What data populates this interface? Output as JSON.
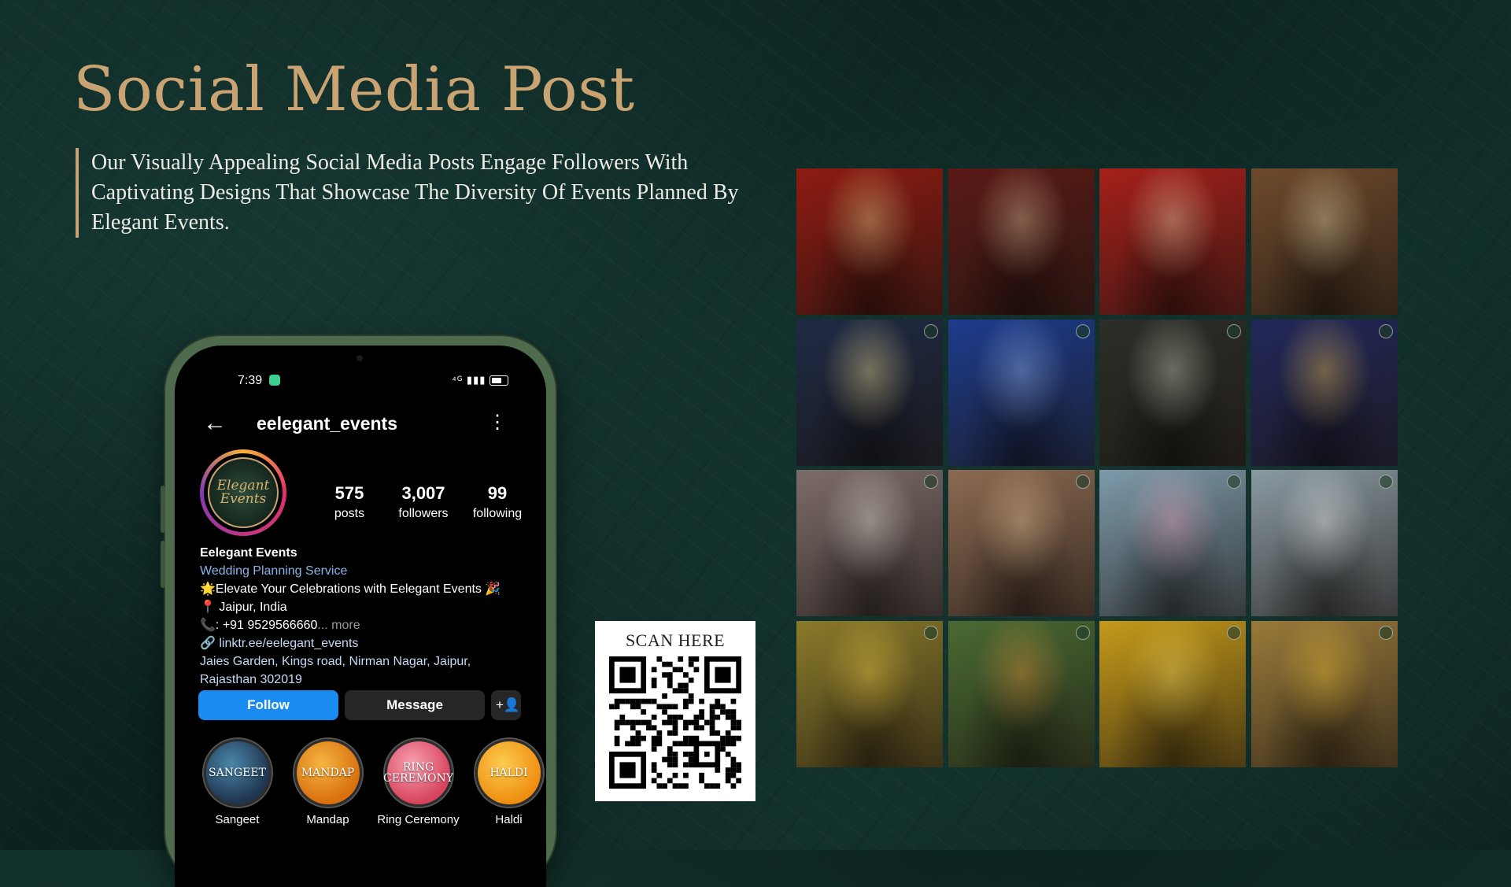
{
  "slide": {
    "title": "Social Media Post",
    "description": "Our Visually Appealing Social Media Posts Engage Followers With Captivating Designs That Showcase The Diversity Of Events Planned By Elegant Events."
  },
  "phone": {
    "status_time": "7:39",
    "status_icons": "⁴ᴳ ▮▮▮",
    "profile": {
      "username": "eelegant_events",
      "avatar_text": "Elegant Events",
      "stats": [
        {
          "num": "575",
          "label": "posts"
        },
        {
          "num": "3,007",
          "label": "followers"
        },
        {
          "num": "99",
          "label": "following"
        }
      ],
      "name": "Eelegant Events",
      "category": "Wedding Planning Service",
      "bio_line1": "🌟Elevate Your Celebrations with Eelegant Events 🎉",
      "location": "📍 Jaipur, India",
      "phone": "📞: +91 9529566660",
      "more": "... more",
      "link": "🔗 linktr.ee/eelegant_events",
      "address": "Jaies Garden, Kings road, Nirman Nagar, Jaipur, Rajasthan 302019"
    },
    "buttons": {
      "follow": "Follow",
      "message": "Message",
      "add_user": "+👤"
    },
    "highlights": [
      {
        "cover": "SANGEET",
        "label": "Sangeet",
        "color": "#2a4a6a"
      },
      {
        "cover": "MANDAP",
        "label": "Mandap",
        "color": "#e8901a"
      },
      {
        "cover": "RING CEREMONY",
        "label": "Ring Ceremony",
        "color": "#e8607a"
      },
      {
        "cover": "HALDI",
        "label": "Haldi",
        "color": "#f3a320"
      }
    ]
  },
  "qr": {
    "label": "SCAN HERE"
  },
  "grid_tiles": [
    {
      "name": "red-mandap-decor",
      "bg": "#8e1b12"
    },
    {
      "name": "couple-portrait",
      "bg": "#5a1a16"
    },
    {
      "name": "crystal-chandelier-red",
      "bg": "#a5201a"
    },
    {
      "name": "outdoor-lounge-setup",
      "bg": "#6e4a2c"
    },
    {
      "name": "hanging-lights-venue",
      "bg": "#1e2a44"
    },
    {
      "name": "blue-lit-gate",
      "bg": "#1d3c8c"
    },
    {
      "name": "white-drape-tent",
      "bg": "#2c2e28"
    },
    {
      "name": "welcome-board",
      "bg": "#22285a"
    },
    {
      "name": "lakeside-floral-mandap",
      "bg": "#7c6c6a"
    },
    {
      "name": "sunset-mandap",
      "bg": "#8c6a52"
    },
    {
      "name": "floral-canopy-pink",
      "bg": "#7d9aaa"
    },
    {
      "name": "white-floral-arch-lake",
      "bg": "#8a9aa2"
    },
    {
      "name": "haldi-yellow-setup",
      "bg": "#8a7a2a"
    },
    {
      "name": "shower-the-couple",
      "bg": "#4a6a32"
    },
    {
      "name": "yellow-drape-sofa",
      "bg": "#c59a1a"
    },
    {
      "name": "marigold-terrace",
      "bg": "#9a7a3a"
    }
  ]
}
